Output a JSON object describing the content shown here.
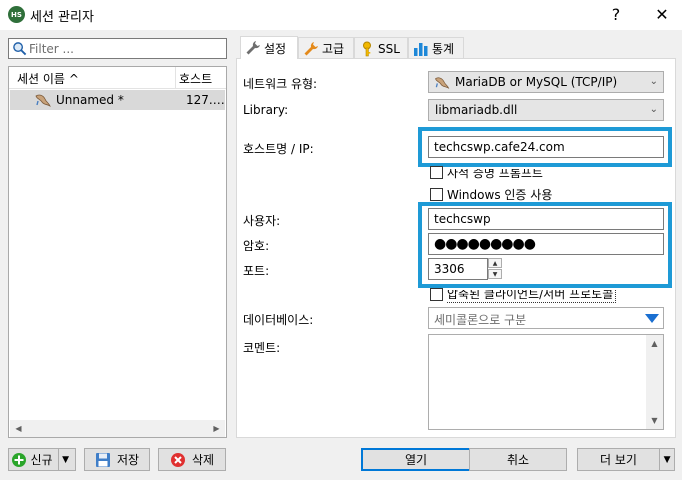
{
  "window": {
    "title": "세션 관리자",
    "logo_text": "HS",
    "help_glyph": "?",
    "close_glyph": "✕"
  },
  "filter": {
    "placeholder": "Filter ..."
  },
  "session_list": {
    "columns": [
      "세션 이름",
      "호스트"
    ],
    "sort_glyph": "^",
    "rows": [
      {
        "name": "Unnamed *",
        "host": "127.…"
      }
    ]
  },
  "tabs": [
    {
      "label": "설정",
      "icon": "wrench-icon",
      "active": true
    },
    {
      "label": "고급",
      "icon": "wrench-orange-icon"
    },
    {
      "label": "SSL",
      "icon": "key-icon"
    },
    {
      "label": "통계",
      "icon": "bar-chart-icon"
    }
  ],
  "settings": {
    "network_type_label": "네트워크 유형:",
    "network_type_value": "MariaDB or MySQL (TCP/IP)",
    "library_label": "Library:",
    "library_value": "libmariadb.dll",
    "host_label": "호스트명 / IP:",
    "host_value": "techcswp.cafe24.com",
    "prompt_checkbox_label": "사적 증명 프롬프트",
    "windows_auth_label": "Windows 인증 사용",
    "user_label": "사용자:",
    "user_value": "techcswp",
    "password_label": "암호:",
    "password_value": "●●●●●●●●●",
    "port_label": "포트:",
    "port_value": "3306",
    "compression_label": "압축된 클라이언트/서버 프로토콜",
    "database_label": "데이터베이스:",
    "database_placeholder": "세미콜론으로 구분",
    "comment_label": "코멘트:"
  },
  "buttons": {
    "new": "신규",
    "save": "저장",
    "delete": "삭제",
    "open": "열기",
    "cancel": "취소",
    "more": "더 보기"
  },
  "colors": {
    "highlight": "#1e9ad6",
    "selected_row": "#d9d9d9",
    "dropdown_arrow": "#1a6fd1"
  }
}
